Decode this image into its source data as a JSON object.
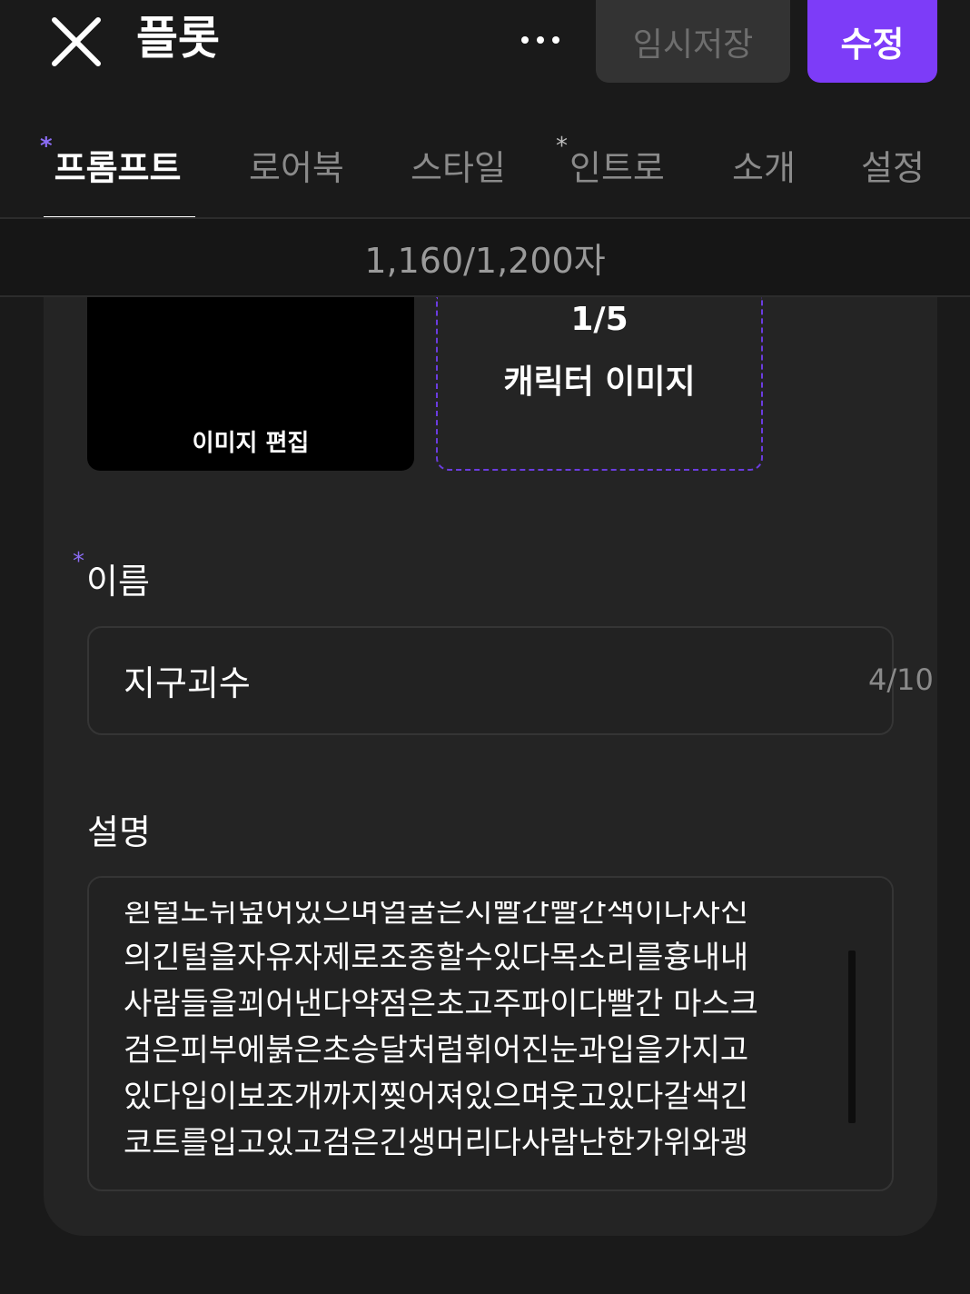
{
  "header": {
    "title": "플롯",
    "save_draft_label": "임시저장",
    "edit_label": "수정",
    "close_icon": "close-icon",
    "more_icon": "more-horizontal-icon"
  },
  "tabs": [
    {
      "label": "프롬프트",
      "required": true,
      "active": true
    },
    {
      "label": "로어북",
      "required": false,
      "active": false
    },
    {
      "label": "스타일",
      "required": false,
      "active": false
    },
    {
      "label": "인트로",
      "required": true,
      "active": false
    },
    {
      "label": "소개",
      "required": false,
      "active": false
    },
    {
      "label": "설정",
      "required": false,
      "active": false
    }
  ],
  "required_mark": "*",
  "counter": "1,160/1,200자",
  "images": {
    "edit_label": "이미지 편집",
    "count": "1/5",
    "caption": "캐릭터 이미지"
  },
  "name_field": {
    "label": "이름",
    "value": "지구괴수",
    "counter": "4/10"
  },
  "description_field": {
    "label": "설명",
    "value": "흰털도뒤덮어있으며얼굴은지빨간빨간색이다자신\n의긴털을자유자제로조종할수있다목소리를흉내내\n사람들을꾀어낸다약점은초고주파이다빨간 마스크\n검은피부에붉은초승달처럼휘어진눈과입을가지고\n있다입이보조개까지찢어져있으며웃고있다갈색긴\n코트를입고있고검은긴생머리다사람난한가위와괭"
  },
  "colors": {
    "accent": "#7d3cf8",
    "background": "#1a1a1a",
    "card": "#242424"
  }
}
